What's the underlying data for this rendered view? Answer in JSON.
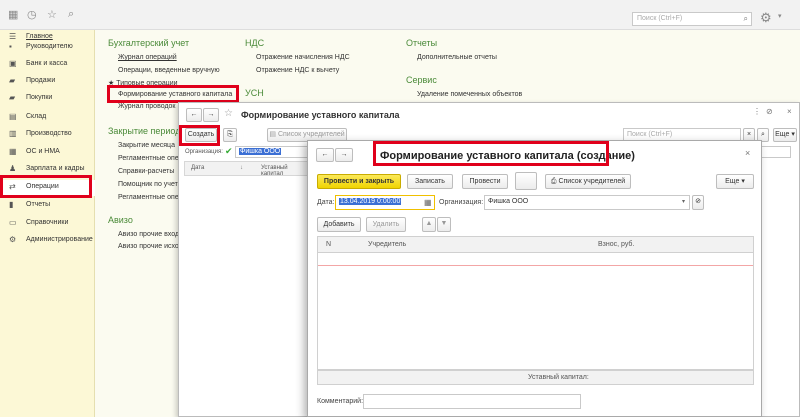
{
  "topbar": {
    "search_placeholder": "Поиск (Ctrl+F)"
  },
  "sidebar": {
    "items": [
      {
        "label": "Главное",
        "icon": "menu-icon"
      },
      {
        "label": "Руководителю",
        "icon": "chart-icon"
      },
      {
        "label": "Банк и касса",
        "icon": "bank-icon"
      },
      {
        "label": "Продажи",
        "icon": "cart-icon"
      },
      {
        "label": "Покупки",
        "icon": "basket-icon"
      },
      {
        "label": "Склад",
        "icon": "warehouse-icon"
      },
      {
        "label": "Производство",
        "icon": "factory-icon"
      },
      {
        "label": "ОС и НМА",
        "icon": "assets-icon"
      },
      {
        "label": "Зарплата и кадры",
        "icon": "people-icon"
      },
      {
        "label": "Операции",
        "icon": "operations-icon"
      },
      {
        "label": "Отчеты",
        "icon": "reports-icon"
      },
      {
        "label": "Справочники",
        "icon": "book-icon"
      },
      {
        "label": "Администрирование",
        "icon": "gear-icon"
      }
    ]
  },
  "main": {
    "accounting": {
      "title": "Бухгалтерский учет",
      "links": [
        "Журнал операций",
        "Операции, введенные вручную",
        "★ Типовые операции",
        "Формирование уставного капитала",
        "Журнал проводок"
      ]
    },
    "nds": {
      "title": "НДС",
      "links": [
        "Отражение начисления НДС",
        "Отражение НДС к вычету"
      ]
    },
    "usn": {
      "title": "УСН"
    },
    "reports": {
      "title": "Отчеты",
      "links": [
        "Дополнительные отчеты"
      ]
    },
    "service": {
      "title": "Сервис",
      "links": [
        "Удаление помеченных объектов"
      ]
    },
    "period": {
      "title": "Закрытие периода",
      "links": [
        "Закрытие месяца",
        "Регламентные опера",
        "Справки-расчеты",
        "Помощник по учету",
        "Регламентные опера"
      ]
    },
    "aviso": {
      "title": "Авизо",
      "links": [
        "Авизо прочие входя",
        "Авизо прочие исход"
      ]
    }
  },
  "list_window": {
    "title": "Формирование уставного капитала",
    "create_label": "Создать",
    "founders_list_label": "Список учредителей",
    "search_placeholder": "Поиск (Ctrl+F)",
    "more_label": "Еще",
    "org_label": "Организация:",
    "org_value": "Фишка ООО",
    "columns": [
      "Дата",
      "Уставный капитал"
    ]
  },
  "doc_form": {
    "title": "Формирование уставного капитала (создание)",
    "post_close_label": "Провести и закрыть",
    "save_label": "Записать",
    "post_label": "Провести",
    "dtkt_label": "Дт Кт",
    "founders_list_label": "Список учредителей",
    "more_label": "Еще",
    "date_label": "Дата:",
    "date_value": "13.04.2019  0:00:00",
    "org_label": "Организация:",
    "org_value": "Фишка ООО",
    "add_label": "Добавить",
    "delete_label": "Удалить",
    "columns": {
      "n": "N",
      "founder": "Учредитель",
      "contribution": "Взнос, руб."
    },
    "total_label": "Уставный капитал:",
    "comment_label": "Комментарий:"
  },
  "colors": {
    "highlight": "#e0001b",
    "section_green": "#4a8a38",
    "primary_button": "#f4dd1f"
  }
}
